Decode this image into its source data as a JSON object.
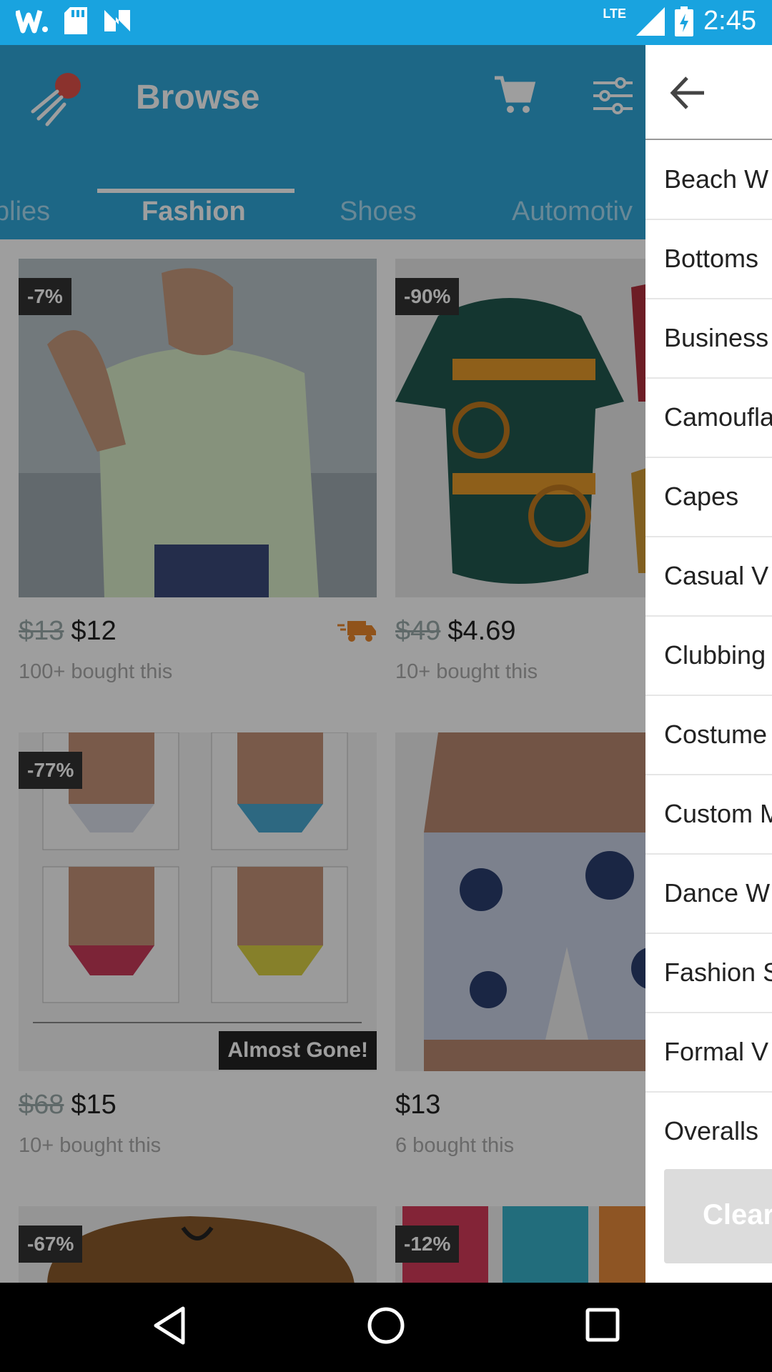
{
  "status_bar": {
    "time": "2:45",
    "network": "LTE"
  },
  "app_bar": {
    "title": "Browse"
  },
  "tabs": [
    "plies",
    "Fashion",
    "Shoes",
    "Automotiv"
  ],
  "products": [
    {
      "badge": "-7%",
      "old_price": "$13",
      "price": "$12",
      "bought": "100+ bought this"
    },
    {
      "badge": "-90%",
      "old_price": "$49",
      "price": "$4.69",
      "bought": "10+ bought this"
    },
    {
      "badge": "-77%",
      "old_price": "$68",
      "price": "$15",
      "bought": "10+ bought this",
      "tag": "Almost Gone!"
    },
    {
      "badge": "",
      "old_price": "",
      "price": "$13",
      "bought": "6 bought this"
    },
    {
      "badge": "-67%"
    },
    {
      "badge": "-12%"
    }
  ],
  "drawer": {
    "items": [
      "Beach W",
      "Bottoms",
      "Business",
      "Camoufla",
      "Capes",
      "Casual V",
      "Clubbing",
      "Costume",
      "Custom M",
      "Dance W",
      "Fashion S",
      "Formal V",
      "Overalls"
    ],
    "clear_label": "Clear"
  },
  "colors": {
    "brand": "#2fa6d9",
    "status_bar": "#19a3df",
    "shipping_icon": "#e8862d"
  }
}
